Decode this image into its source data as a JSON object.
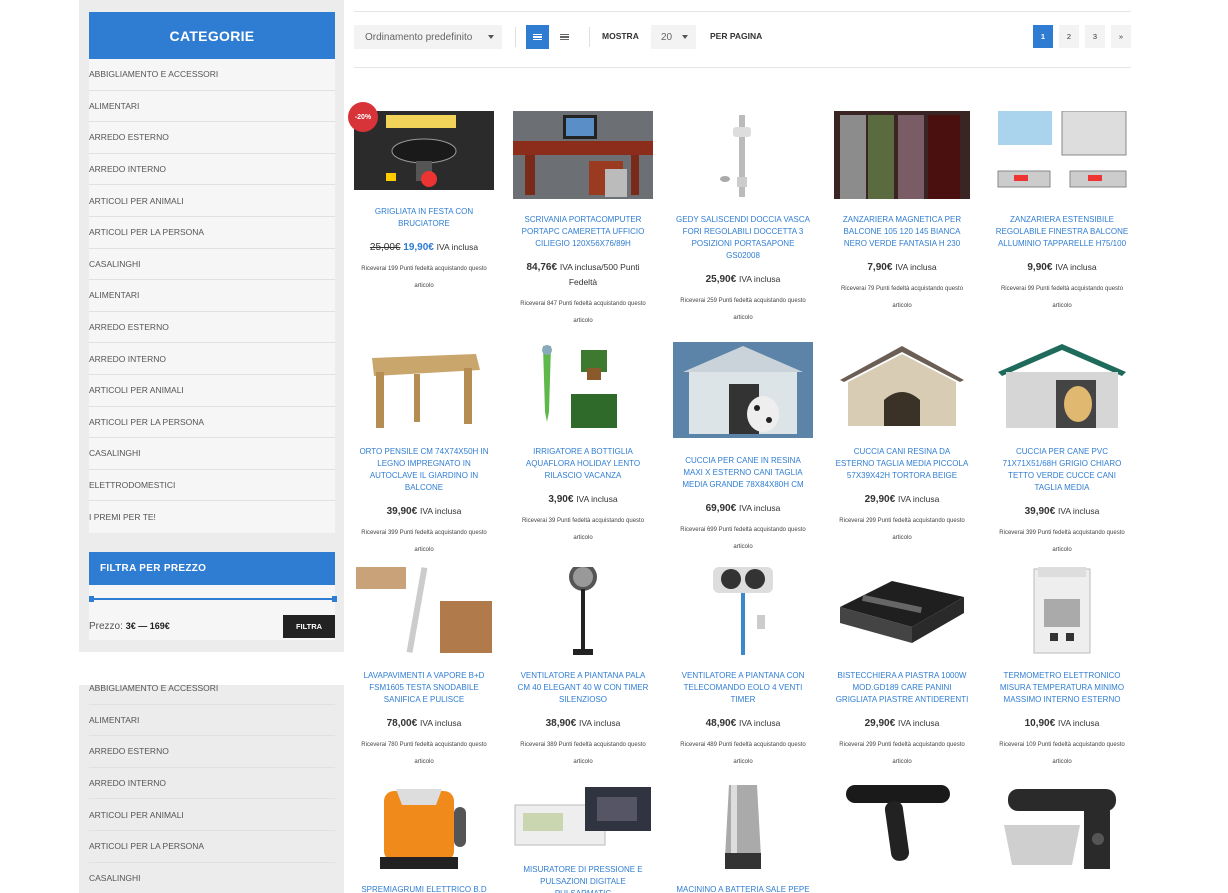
{
  "sidebar": {
    "categories_title": "CATEGORIE",
    "categories": [
      "ABBIGLIAMENTO E ACCESSORI",
      "ALIMENTARI",
      "ARREDO ESTERNO",
      "ARREDO INTERNO",
      "ARTICOLI PER ANIMALI",
      "ARTICOLI PER LA PERSONA",
      "CASALINGHI",
      "ALIMENTARI",
      "ARREDO ESTERNO",
      "ARREDO INTERNO",
      "ARTICOLI PER ANIMALI",
      "ARTICOLI PER LA PERSONA",
      "CASALINGHI",
      "ELETTRODOMESTICI",
      "I PREMI PER TE!"
    ],
    "filter_title": "FILTRA PER PREZZO",
    "price_prefix": "Prezzo:",
    "price_range": "3€ — 169€",
    "filter_button": "FILTRA",
    "categories_repeat": [
      "ABBIGLIAMENTO E ACCESSORI",
      "ALIMENTARI",
      "ARREDO ESTERNO",
      "ARREDO INTERNO",
      "ARTICOLI PER ANIMALI",
      "ARTICOLI PER LA PERSONA",
      "CASALINGHI"
    ]
  },
  "toolbar": {
    "sort_value": "Ordinamento predefinito",
    "show_label": "MOSTRA",
    "per_page_value": "20",
    "per_page_label": "PER PAGINA",
    "pages": [
      "1",
      "2",
      "3",
      "»"
    ],
    "active_page": "1",
    "accent_color": "#2f7dd3"
  },
  "sale_badge": "-20%",
  "products": [
    {
      "title": "GRIGLIATA IN FESTA CON BRUCIATORE",
      "old_price": "25,00€",
      "price": "19,90€",
      "iva": "IVA inclusa",
      "points": "Riceverai 199 Punti fedeltà acquistando questo articolo",
      "image": "grill-icon"
    },
    {
      "title": "SCRIVANIA PORTACOMPUTER PORTAPC CAMERETTA UFFICIO CILIEGIO 120X56X76/89H",
      "price": "84,76€",
      "iva": "IVA inclusa/500 Punti Fedeltà",
      "points": "Riceverai 847 Punti fedeltà acquistando questo articolo",
      "image": "desk-icon"
    },
    {
      "title": "GEDY SALISCENDI DOCCIA VASCA FORI REGOLABILI DOCCETTA 3 POSIZIONI PORTASAPONE GS02008",
      "price": "25,90€",
      "iva": "IVA inclusa",
      "points": "Riceverai 259 Punti fedeltà acquistando questo articolo",
      "image": "shower-icon"
    },
    {
      "title": "ZANZARIERA MAGNETICA PER BALCONE 105 120 145 BIANCA NERO VERDE FANTASIA H 230",
      "price": "7,90€",
      "iva": "IVA inclusa",
      "points": "Riceverai 79 Punti fedeltà acquistando questo articolo",
      "image": "curtain-icon"
    },
    {
      "title": "ZANZARIERA ESTENSIBILE REGOLABILE FINESTRA BALCONE ALLUMINIO TAPPARELLE H75/100",
      "price": "9,90€",
      "iva": "IVA inclusa",
      "points": "Riceverai 99 Punti fedeltà acquistando questo articolo",
      "image": "screen-icon"
    },
    {
      "title": "ORTO PENSILE CM 74X74X50H IN LEGNO IMPREGNATO IN AUTOCLAVE IL GIARDINO IN BALCONE",
      "price": "39,90€",
      "iva": "IVA inclusa",
      "points": "Riceverai 399 Punti fedeltà acquistando questo articolo",
      "image": "planter-icon"
    },
    {
      "title": "IRRIGATORE A BOTTIGLIA AQUAFLORA HOLIDAY LENTO RILASCIO VACANZA",
      "price": "3,90€",
      "iva": "IVA inclusa",
      "points": "Riceverai 39 Punti fedeltà acquistando questo articolo",
      "image": "irrigator-icon"
    },
    {
      "title": "CUCCIA PER CANE IN RESINA MAXI X ESTERNO CANI TAGLIA MEDIA GRANDE 78X84X80H CM",
      "price": "69,90€",
      "iva": "IVA inclusa",
      "points": "Riceverai 699 Punti fedeltà acquistando questo articolo",
      "image": "doghouse-icon"
    },
    {
      "title": "CUCCIA CANI RESINA DA ESTERNO TAGLIA MEDIA PICCOLA 57X39X42H TORTORA BEIGE",
      "price": "29,90€",
      "iva": "IVA inclusa",
      "points": "Riceverai 299 Punti fedeltà acquistando questo articolo",
      "image": "doghouse-beige-icon"
    },
    {
      "title": "CUCCIA PER CANE PVC 71X71X51/68H GRIGIO CHIARO TETTO VERDE CUCCE CANI TAGLIA MEDIA",
      "price": "39,90€",
      "iva": "IVA inclusa",
      "points": "Riceverai 399 Punti fedeltà acquistando questo articolo",
      "image": "doghouse-green-icon"
    },
    {
      "title": "LAVAPAVIMENTI A VAPORE B+D FSM1605 TESTA SNODABILE SANIFICA E PULISCE",
      "price": "78,00€",
      "iva": "IVA inclusa",
      "points": "Riceverai 780 Punti fedeltà acquistando questo articolo",
      "image": "steam-mop-icon"
    },
    {
      "title": "VENTILATORE A PIANTANA PALA CM 40 ELEGANT 40 W CON TIMER SILENZIOSO",
      "price": "38,90€",
      "iva": "IVA inclusa",
      "points": "Riceverai 389 Punti fedeltà acquistando questo articolo",
      "image": "fan-icon"
    },
    {
      "title": "VENTILATORE A PIANTANA CON TELECOMANDO EOLO 4 VENTI TIMER",
      "price": "48,90€",
      "iva": "IVA inclusa",
      "points": "Riceverai 489 Punti fedeltà acquistando questo articolo",
      "image": "fan-double-icon"
    },
    {
      "title": "BISTECCHIERA A PIASTRA 1000W MOD.GD189 CARE PANINI GRIGLIATA PIASTRE ANTIDERENTI",
      "price": "29,90€",
      "iva": "IVA inclusa",
      "points": "Riceverai 299 Punti fedeltà acquistando questo articolo",
      "image": "grill-press-icon"
    },
    {
      "title": "TERMOMETRO ELETTRONICO MISURA TEMPERATURA MINIMO MASSIMO INTERNO ESTERNO",
      "price": "10,90€",
      "iva": "IVA inclusa",
      "points": "Riceverai 109 Punti fedeltà acquistando questo articolo",
      "image": "thermometer-icon"
    },
    {
      "title": "SPREMIAGRUMI ELETTRICO B.D MOD",
      "image": "juicer-icon"
    },
    {
      "title": "MISURATORE DI PRESSIONE E PULSAZIONI DIGITALE PULSARMATIC",
      "image": "blood-pressure-icon"
    },
    {
      "title": "MACININO A BATTERIA SALE PEPE",
      "image": "pepper-mill-icon"
    },
    {
      "title": "",
      "image": "hair-dryer-icon"
    },
    {
      "title": "",
      "image": "mixer-icon"
    }
  ]
}
